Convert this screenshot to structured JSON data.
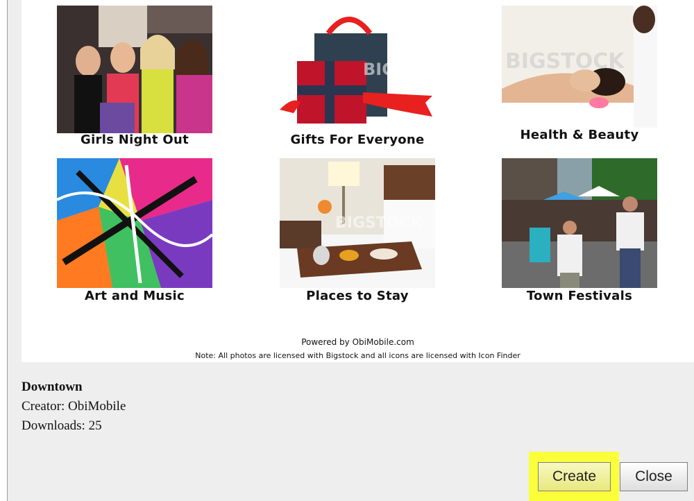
{
  "tiles": [
    {
      "label": "Girls Night Out",
      "icon": "party-photo"
    },
    {
      "label": "Gifts For Everyone",
      "icon": "gift-photo"
    },
    {
      "label": "Health & Beauty",
      "icon": "spa-photo"
    },
    {
      "label": "Art and Music",
      "icon": "art-music-photo"
    },
    {
      "label": "Places to Stay",
      "icon": "hotel-photo"
    },
    {
      "label": "Town Festivals",
      "icon": "festival-photo"
    }
  ],
  "watermark": "BIGSTOCK",
  "footer": {
    "powered": "Powered by ObiMobile.com",
    "note": "Note: All photos are licensed with Bigstock and all icons are licensed with Icon Finder"
  },
  "info": {
    "name": "Downtown",
    "creator": "Creator: ObiMobile",
    "downloads": "Downloads: 25"
  },
  "buttons": {
    "create": "Create",
    "close": "Close"
  },
  "colors": {
    "highlight": "#fbff39"
  }
}
